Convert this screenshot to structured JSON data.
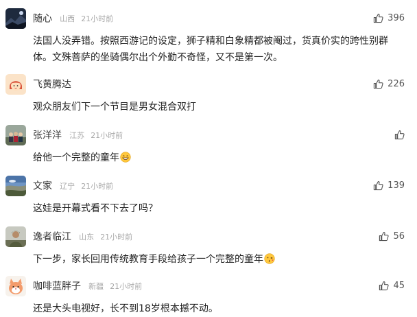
{
  "comments": [
    {
      "user": "随心",
      "location": "山西",
      "time": "21小时前",
      "likes": "396",
      "text": "法国人没弄错。按照西游记的设定，狮子精和白象精都被阉过，货真价实的跨性别群体。文殊菩萨的坐骑偶尔出个外勤不奇怪，又不是第一次。",
      "avatar": "dark-mountain-photo"
    },
    {
      "user": "飞黄腾达",
      "location": "",
      "time": "",
      "likes": "226",
      "text": "观众朋友们下一个节目是男女混合双打",
      "avatar": "cartoon-girl"
    },
    {
      "user": "张洋洋",
      "location": "江苏",
      "time": "21小时前",
      "likes": "",
      "text": "给他一个完整的童年",
      "emoji": "grin-emoji",
      "avatar": "group-photo"
    },
    {
      "user": "文家",
      "location": "辽宁",
      "time": "21小时前",
      "likes": "139",
      "text": "这娃是开幕式看不下去了吗？",
      "avatar": "sky-landscape-photo"
    },
    {
      "user": "逸者临江",
      "location": "山东",
      "time": "21小时前",
      "likes": "56",
      "text": "下一步，家长回用传统教育手段给孩子一个完整的童年",
      "emoji": "kiss-emoji",
      "avatar": "soldier-photo"
    },
    {
      "user": "咖啡蓝胖子",
      "location": "新疆",
      "time": "21小时前",
      "likes": "45",
      "text": "还是大头电视好，长不到18岁根本撼不动。",
      "avatar": "cartoon-cat"
    }
  ],
  "colors": {
    "name": "#333333",
    "meta": "#a8a8a8",
    "text": "#222222",
    "like": "#555555"
  }
}
